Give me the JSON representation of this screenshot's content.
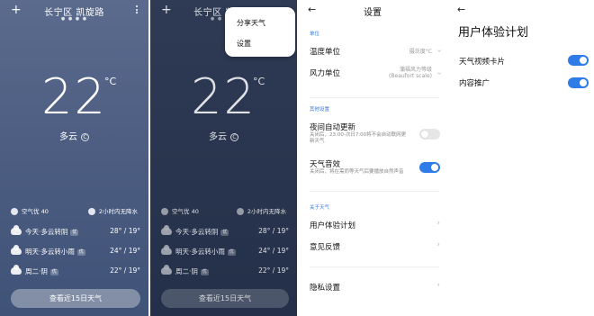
{
  "weather": {
    "add_icon": "plus-icon",
    "location": "长宁区 凯旋路",
    "page_dots": "● ● ● ●",
    "temperature": "22",
    "temp_unit": "°C",
    "condition": "多云",
    "condition_badge": "C",
    "air_quality": "空气优 40",
    "rain_forecast": "2小时内无降水",
    "forecast": [
      {
        "label": "今天·多云转阴",
        "tag": "优",
        "temps": "28° / 19°"
      },
      {
        "label": "明天·多云转小雨",
        "tag": "优",
        "temps": "24° / 19°"
      },
      {
        "label": "周二·阴",
        "tag": "优",
        "temps": "22° / 19°"
      }
    ],
    "forecast_button": "查看近15日天气"
  },
  "menu": {
    "share": "分享天气",
    "settings": "设置"
  },
  "settings": {
    "title": "设置",
    "section_units": "单位",
    "temp_unit_label": "温度单位",
    "temp_unit_value": "摄氏度°C",
    "wind_unit_label": "风力单位",
    "wind_unit_value_1": "蒲福风力等级",
    "wind_unit_value_2": "(Beaufort scale)",
    "section_other": "其他设置",
    "night_update_label": "夜间自动更新",
    "night_update_sub": "关闭后，23:00-次日7:00将不会自动联网更新天气",
    "night_update_on": false,
    "sound_label": "天气音效",
    "sound_sub": "关闭后，将在需而等天气后要播放自然声音",
    "sound_on": true,
    "section_about": "关于天气",
    "ux_plan": "用户体验计划",
    "feedback": "意见反馈",
    "privacy": "隐私设置"
  },
  "ux_plan": {
    "title": "用户体验计划",
    "video_card_label": "天气视频卡片",
    "video_card_on": true,
    "content_promo_label": "内容推广",
    "content_promo_on": true
  },
  "colors": {
    "accent": "#2f7be8",
    "section": "#3a78d8"
  }
}
